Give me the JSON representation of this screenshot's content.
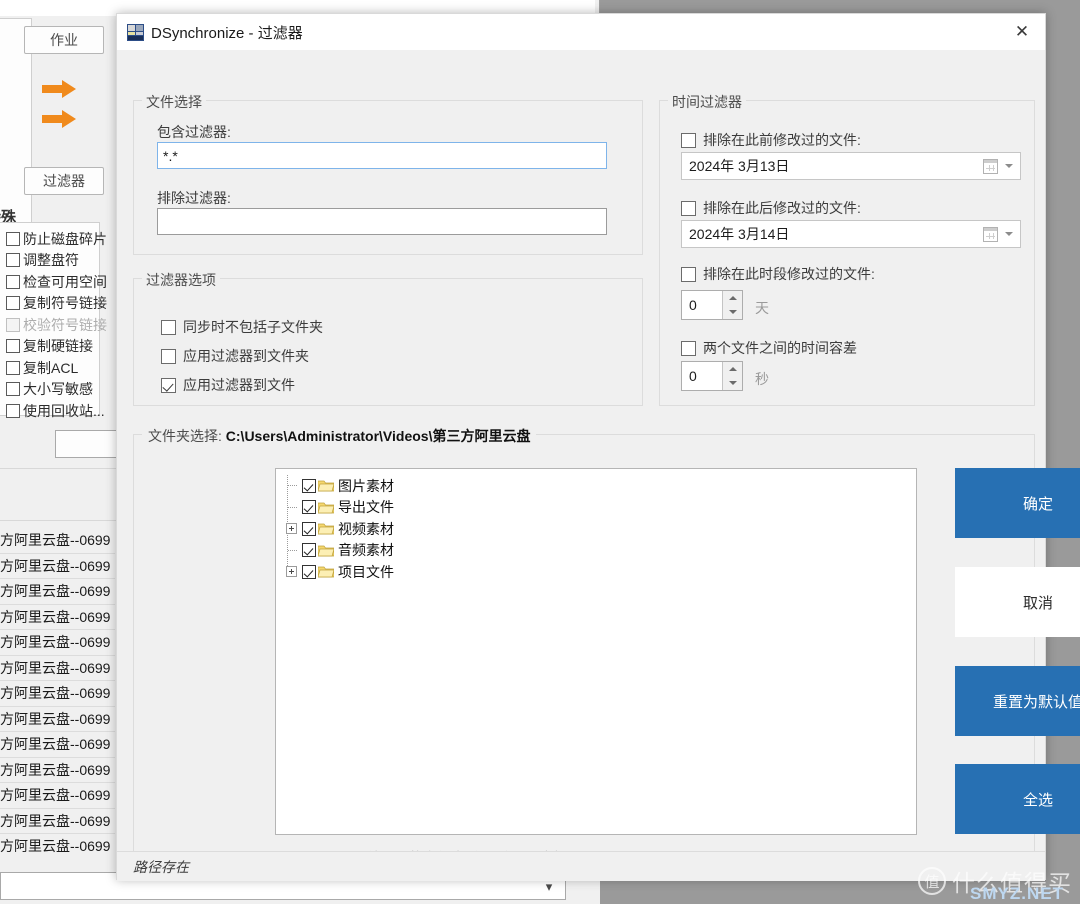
{
  "window": {
    "title": "DSynchronize - 过滤器",
    "icon": "app-icon",
    "close_label": "✕"
  },
  "file_selection": {
    "legend": "文件选择",
    "include_label": "包含过滤器:",
    "include_value": "*.*",
    "include_placeholder": "",
    "exclude_label": "排除过滤器:",
    "exclude_value": "",
    "exclude_placeholder": ""
  },
  "filter_options": {
    "legend": "过滤器选项",
    "items": [
      {
        "label": "同步时不包括子文件夹",
        "checked": false
      },
      {
        "label": "应用过滤器到文件夹",
        "checked": false
      },
      {
        "label": "应用过滤器到文件",
        "checked": true
      }
    ]
  },
  "time_filter": {
    "legend": "时间过滤器",
    "before": {
      "label": "排除在此前修改过的文件:",
      "checked": false,
      "date": "2024年  3月13日"
    },
    "after": {
      "label": "排除在此后修改过的文件:",
      "checked": false,
      "date": "2024年  3月14日"
    },
    "range": {
      "label": "排除在此时段修改过的文件:",
      "checked": false,
      "value": "0",
      "unit": "天"
    },
    "tolerance": {
      "label": "两个文件之间的时间容差",
      "checked": false,
      "value": "0",
      "unit": "秒"
    }
  },
  "folder_selection": {
    "legend_lead": "文件夹选择: ",
    "path": "C:\\Users\\Administrator\\Videos\\第三方阿里云盘",
    "tree": [
      {
        "label": "图片素材",
        "checked": true,
        "expandable": false
      },
      {
        "label": "导出文件",
        "checked": true,
        "expandable": false
      },
      {
        "label": "视频素材",
        "checked": true,
        "expandable": true
      },
      {
        "label": "音频素材",
        "checked": true,
        "expandable": false
      },
      {
        "label": "项目文件",
        "checked": true,
        "expandable": true
      }
    ],
    "no_autoadd": {
      "label": "不要同步后续添加的文件夹(会导致同步变慢)",
      "checked": false
    }
  },
  "buttons": {
    "ok": "确定",
    "cancel": "取消",
    "reset": "重置为默认值",
    "select_all": "全选"
  },
  "statusbar": {
    "text": "路径存在"
  },
  "background": {
    "job_button": "作业",
    "filter_button": "过滤器",
    "special_group": "特殊",
    "special_items": [
      {
        "label": "防止磁盘碎片",
        "checked": false,
        "disabled": false
      },
      {
        "label": "调整盘符",
        "checked": false,
        "disabled": false
      },
      {
        "label": "检查可用空间",
        "checked": false,
        "disabled": false
      },
      {
        "label": "复制符号链接",
        "checked": false,
        "disabled": false
      },
      {
        "label": "校验符号链接",
        "checked": false,
        "disabled": true
      },
      {
        "label": "复制硬链接",
        "checked": false,
        "disabled": false
      },
      {
        "label": "复制ACL",
        "checked": false,
        "disabled": false
      },
      {
        "label": "大小写敏感",
        "checked": false,
        "disabled": false
      },
      {
        "label": "使用回收站...",
        "checked": false,
        "disabled": false
      }
    ],
    "list_rows": [
      "方阿里云盘--0699",
      "方阿里云盘--0699",
      "方阿里云盘--0699",
      "方阿里云盘--0699",
      "方阿里云盘--0699",
      "方阿里云盘--0699",
      "方阿里云盘--0699",
      "方阿里云盘--0699",
      "方阿里云盘--0699",
      "方阿里云盘--0699",
      "方阿里云盘--0699",
      "方阿里云盘--0699",
      "方阿里云盘--0699",
      "方阿里云盘--0699"
    ]
  },
  "watermark": {
    "mark": "值",
    "text": "什么值得买",
    "sub": "SMYZ.NET"
  },
  "colors": {
    "accent": "#2770b3",
    "dialog_bg": "#f0f0f0",
    "focus_border": "#7eb4ea"
  }
}
